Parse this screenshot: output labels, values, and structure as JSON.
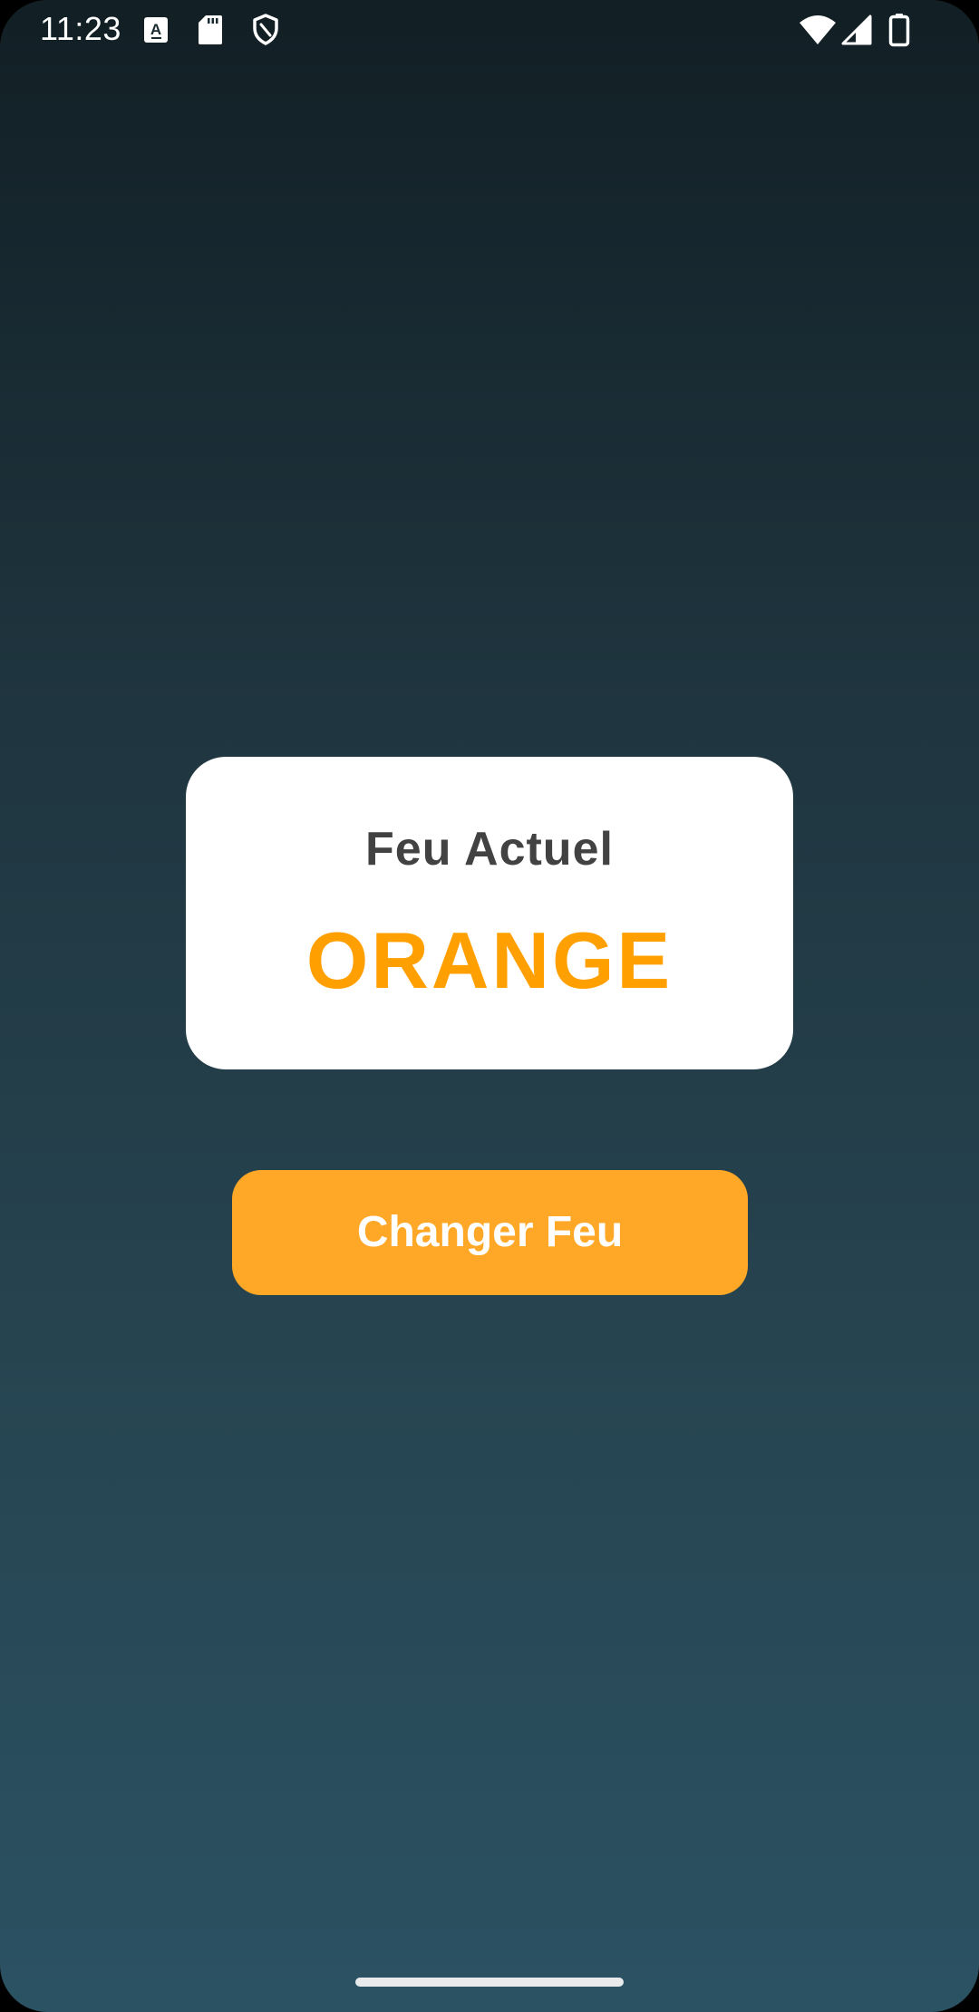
{
  "status_bar": {
    "time": "11:23",
    "left_icons": [
      "text-a-icon",
      "sd-card-icon",
      "shield-icon"
    ],
    "right_icons": [
      "wifi-icon",
      "cell-signal-icon",
      "battery-icon"
    ]
  },
  "card": {
    "title": "Feu Actuel",
    "value": "ORANGE"
  },
  "button": {
    "label": "Changer Feu"
  },
  "colors": {
    "accent_orange": "#FFA726",
    "value_orange": "#FFA000",
    "title_gray": "#424242",
    "card_background": "#FFFFFF",
    "background_top": "#121F25",
    "background_bottom": "#2B5263"
  }
}
